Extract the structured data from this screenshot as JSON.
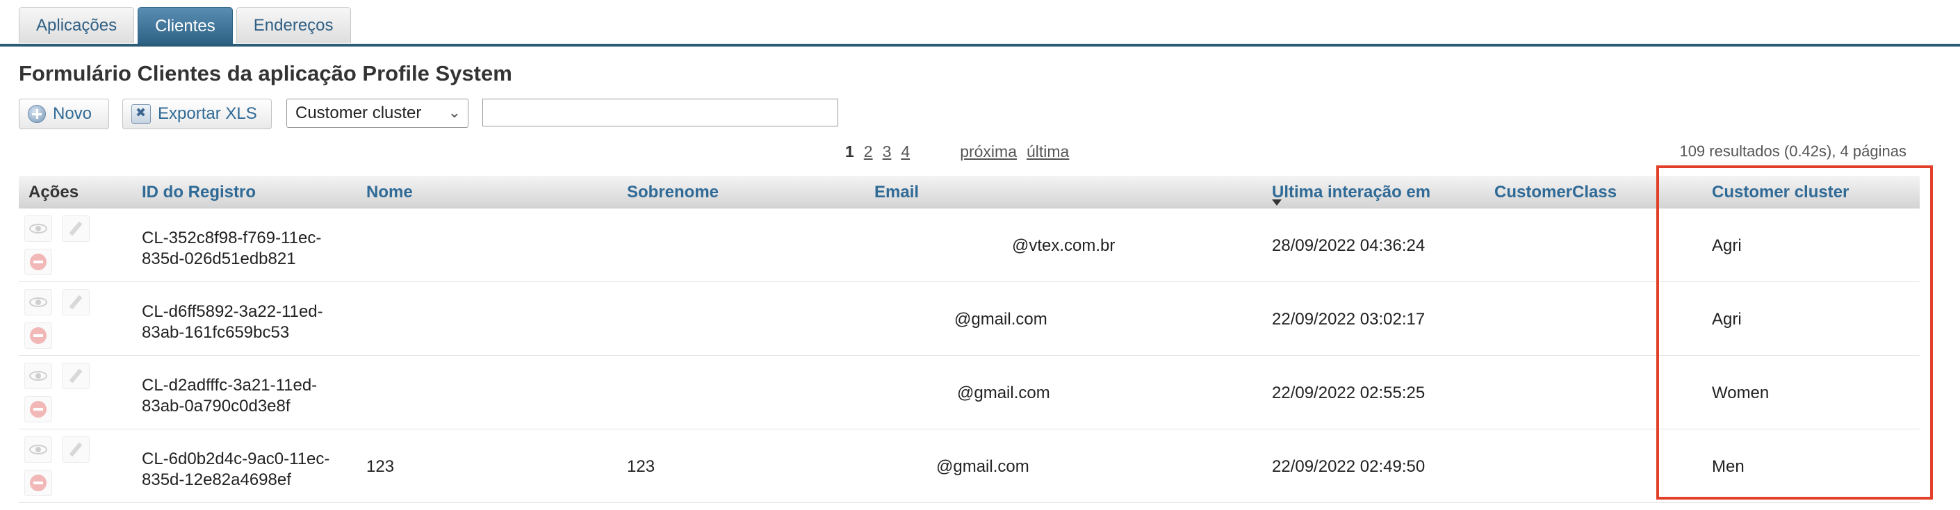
{
  "tabs": [
    {
      "label": "Aplicações"
    },
    {
      "label": "Clientes"
    },
    {
      "label": "Endereços"
    }
  ],
  "page_title": "Formulário Clientes da aplicação Profile System",
  "toolbar": {
    "new_label": "Novo",
    "export_label": "Exportar XLS",
    "filter_select_value": "Customer cluster",
    "search_value": ""
  },
  "pagination": {
    "current": "1",
    "pages": [
      "2",
      "3",
      "4"
    ],
    "next_label": "próxima",
    "last_label": "última",
    "results_text": "109 resultados (0.42s), 4 páginas"
  },
  "table": {
    "columns": {
      "actions": "Ações",
      "id": "ID do Registro",
      "first_name": "Nome",
      "last_name": "Sobrenome",
      "email": "Email",
      "last_interaction": "Ultima interação em",
      "customer_class": "CustomerClass",
      "customer_cluster": "Customer cluster"
    },
    "rows": [
      {
        "id_line1": "CL-352c8f98-f769-11ec-",
        "id_line2": "835d-026d51edb821",
        "first_name": "",
        "last_name": "",
        "email": "@vtex.com.br",
        "last_interaction": "28/09/2022 04:36:24",
        "customer_class": "",
        "customer_cluster": "Agri"
      },
      {
        "id_line1": "CL-d6ff5892-3a22-11ed-",
        "id_line2": "83ab-161fc659bc53",
        "first_name": "",
        "last_name": "",
        "email": "@gmail.com",
        "last_interaction": "22/09/2022 03:02:17",
        "customer_class": "",
        "customer_cluster": "Agri"
      },
      {
        "id_line1": "CL-d2adfffc-3a21-11ed-",
        "id_line2": "83ab-0a790c0d3e8f",
        "first_name": "",
        "last_name": "",
        "email": "@gmail.com",
        "last_interaction": "22/09/2022 02:55:25",
        "customer_class": "",
        "customer_cluster": "Women"
      },
      {
        "id_line1": "CL-6d0b2d4c-9ac0-11ec-",
        "id_line2": "835d-12e82a4698ef",
        "first_name": "123",
        "last_name": "123",
        "email": "@gmail.com",
        "last_interaction": "22/09/2022 02:49:50",
        "customer_class": "",
        "customer_cluster": "Men"
      }
    ]
  },
  "colors": {
    "tab_active": "#2c6184",
    "link": "#2f6a96",
    "highlight_box": "#e2402a"
  }
}
